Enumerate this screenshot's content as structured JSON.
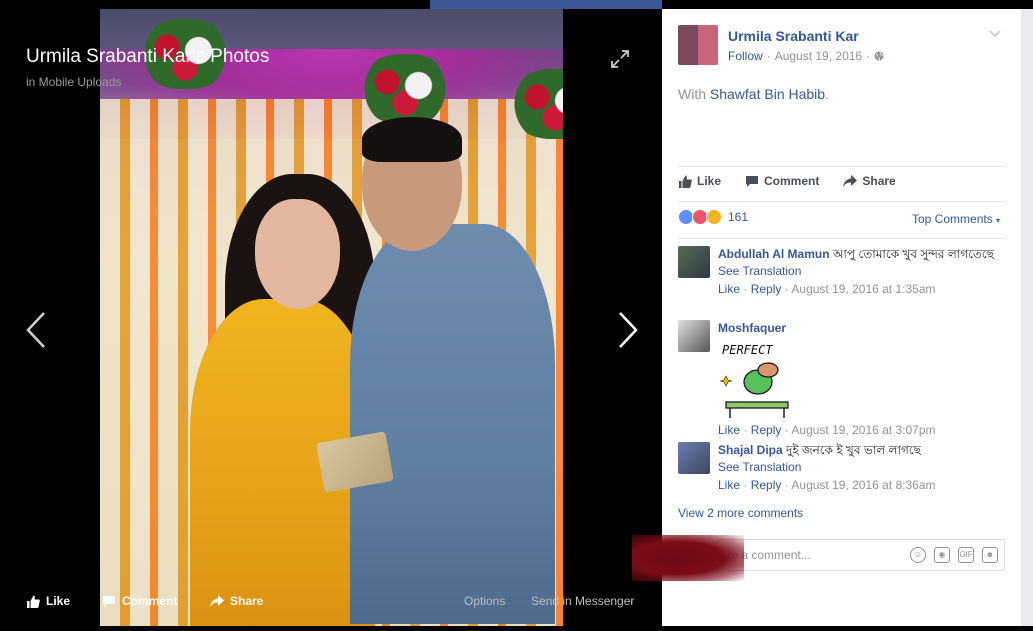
{
  "photo": {
    "title": "Urmila Srabanti Kar's Photos",
    "album": "in Mobile Uploads",
    "actions": {
      "like": "Like",
      "comment": "Comment",
      "share": "Share",
      "options": "Options",
      "send": "Send in Messenger"
    }
  },
  "post": {
    "author": "Urmila Srabanti Kar",
    "follow": "Follow",
    "date": "August 19, 2016",
    "with_prefix": "With",
    "tagged": "Shawfat Bin Habib",
    "with_suffix": ".",
    "actions": {
      "like": "Like",
      "comment": "Comment",
      "share": "Share"
    },
    "reaction_count": "161",
    "sort_label": "Top Comments"
  },
  "comments": [
    {
      "name": "Abdullah Al Mamun",
      "text": "আপু তোমাকে খুব সুন্দর লাগতেছে",
      "translate": "See Translation",
      "like": "Like",
      "reply": "Reply",
      "time": "August 19, 2016 at 1:35am"
    },
    {
      "name": "Moshfaquer",
      "sticker_text": "PERFECT",
      "like": "Like",
      "reply": "Reply",
      "time": "August 19, 2016 at 3:07pm"
    },
    {
      "name": "Shajal Dipa",
      "text": "দুই জনকে ই খুব ভাল লাগছে",
      "translate": "See Translation",
      "like": "Like",
      "reply": "Reply",
      "time": "August 19, 2016 at 8:36am"
    }
  ],
  "view_more": "View 2 more comments",
  "write_placeholder": "te a comment...",
  "colors": {
    "link": "#365899",
    "brand": "#3b5998"
  }
}
